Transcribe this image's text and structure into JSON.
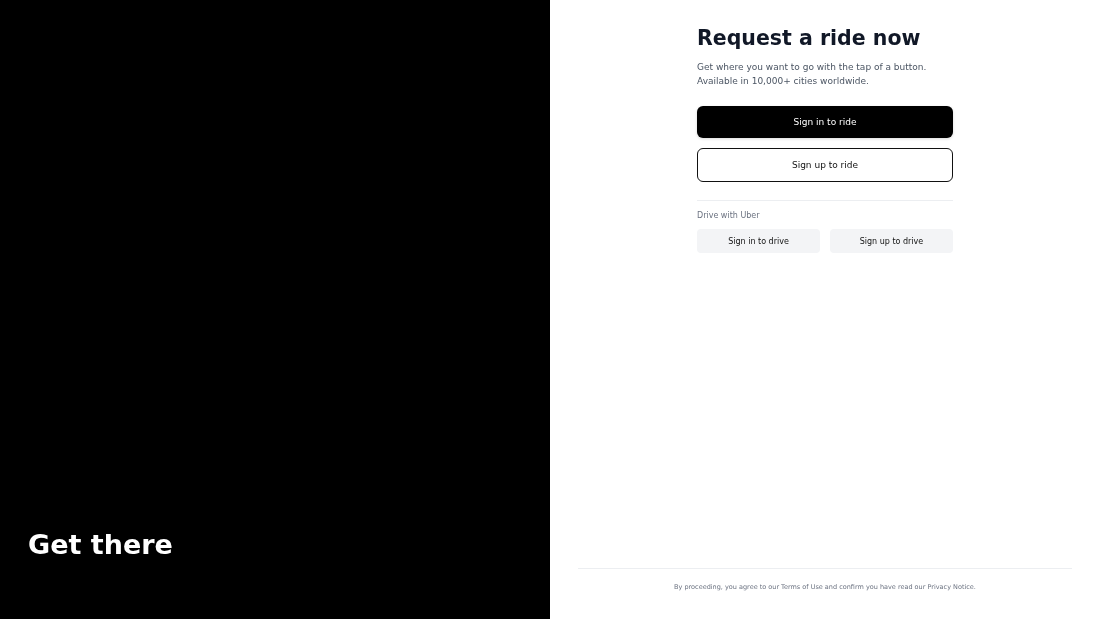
{
  "hero": {
    "heading": "Get there"
  },
  "signup": {
    "title": "Request a ride now",
    "subtitle": "Get where you want to go with the tap of a button. Available in 10,000+ cities worldwide.",
    "ride_buttons": [
      {
        "label": "Sign in to ride",
        "kind": "primary"
      },
      {
        "label": "Sign up to ride",
        "kind": "secondary"
      }
    ],
    "drive_section": {
      "heading": "Drive with Uber",
      "buttons": [
        {
          "label": "Sign in to drive"
        },
        {
          "label": "Sign up to drive"
        }
      ]
    }
  },
  "footer": {
    "notice": "By proceeding, you agree to our Terms of Use and confirm you have read our Privacy Notice."
  }
}
